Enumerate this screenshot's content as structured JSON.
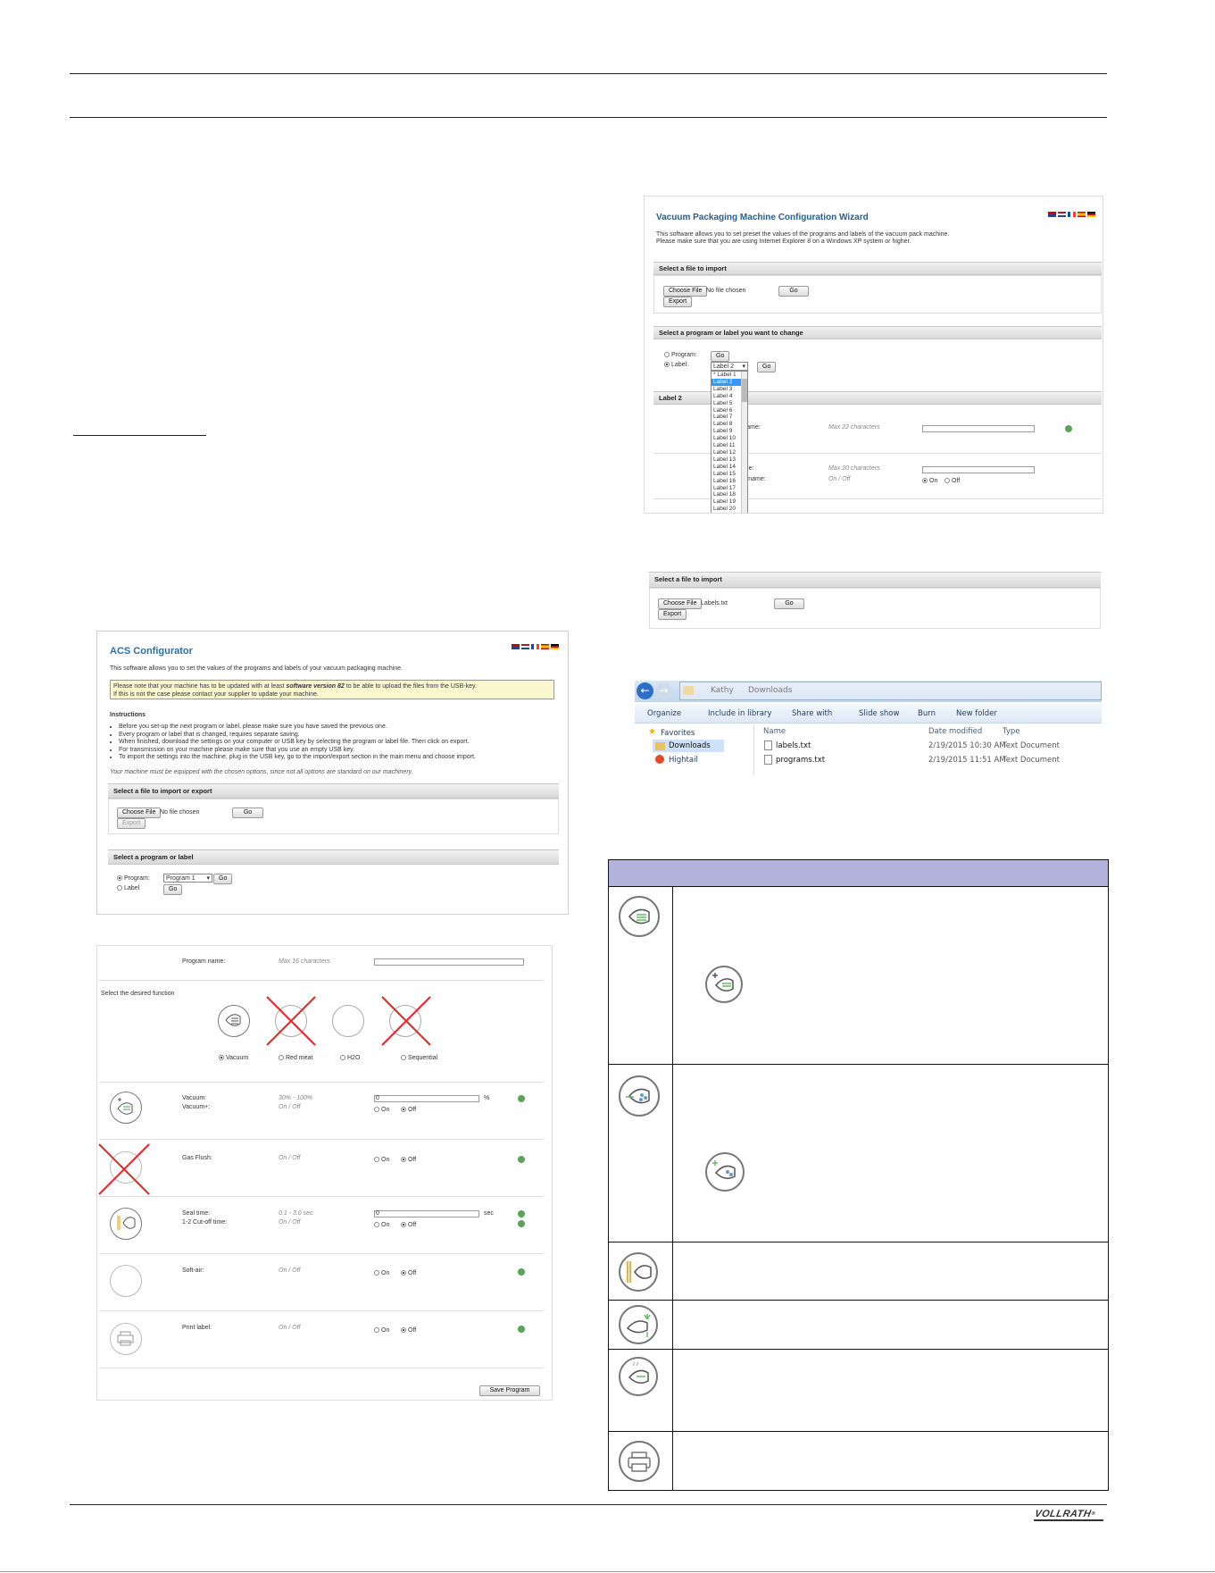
{
  "left_shots": {
    "acs": {
      "title": "ACS Configurator",
      "intro": "This software allows you to set the values of the programs and labels of your vacuum packaging machine.",
      "note_line1_pre": "Please note that your machine has to be updated with at least",
      "note_line1_bold": "software version 82",
      "note_line1_post": "to be able to upload the files from the USB-key.",
      "note_line2": "If this is not the case please contact your supplier to update your machine.",
      "instructions_heading": "Instructions",
      "instructions": [
        "Before you set-up the next program or label, please make sure you have saved the previous one.",
        "Every program or label that is changed, requires separate saving.",
        "When finished, download the settings on your computer or USB key by selecting the program or label file. Then click on export.",
        "For transmission on your machine please make sure that you use an empty USB key.",
        "To import the settings into the machine, plug in the USB key, go to the import/export section in the main menu and choose import."
      ],
      "options_note": "Your machine must be equipped with the chosen options, since not all options are standard on our machinery.",
      "import_section": "Select a file to import or export",
      "choose_file": "Choose File",
      "no_file": "No file chosen",
      "go": "Go",
      "export": "Export",
      "program_section": "Select a program or label",
      "program_label": "Program:",
      "label_label": "Label",
      "program_selected": "Program 1"
    },
    "program_form": {
      "program_name": "Program name:",
      "program_name_hint": "Max 16 characters",
      "select_function": "Select the desired function",
      "functions": [
        "Vacuum",
        "Red meat",
        "H2O",
        "Sequential"
      ],
      "rows": [
        {
          "label1": "Vacuum:",
          "label2": "Vacuum+:",
          "hint1": "30% - 100%",
          "hint2": "On / Off",
          "unit": "%",
          "value": "0"
        },
        {
          "label1": "Gas Flush:",
          "hint1": "On / Off"
        },
        {
          "label1": "Seal time:",
          "label2": "1-2 Cut-off time:",
          "hint1": "0.1 - 3.0 sec",
          "hint2": "On / Off",
          "unit": "sec",
          "value": "0"
        },
        {
          "label1": "Soft-air:",
          "hint1": "On / Off"
        },
        {
          "label1": "Print label:",
          "hint1": "On / Off"
        }
      ],
      "on": "On",
      "off": "Off",
      "save": "Save Program"
    }
  },
  "right_shots": {
    "wizard": {
      "title": "Vacuum Packaging Machine Configuration Wizard",
      "intro1": "This software allows you to set preset the values of the programs and labels of the vacuum pack machine.",
      "intro2": "Please make sure that you are using Internet Explorer 8 on a Windows XP system or higher.",
      "import_section": "Select a file to import",
      "choose_file": "Choose File",
      "no_file": "No file chosen",
      "go": "Go",
      "export": "Export",
      "change_section": "Select a program or label you want to change",
      "program_label": "Program:",
      "label_label": "Label:",
      "label_selected": "Label 2",
      "label_options": [
        "* Label 1",
        "Label 2",
        "Label 3",
        "Label 4",
        "Label 5",
        "Label 6",
        "Label 7",
        "Label 8",
        "Label 9",
        "Label 10",
        "Label 11",
        "Label 12",
        "Label 13",
        "Label 14",
        "Label 15",
        "Label 16",
        "Label 17",
        "Label 18",
        "Label 19",
        "Label 20"
      ],
      "label2_section": "Label 2",
      "text_name": "xt name:",
      "text_name_hint": "Max 22 characters",
      "name2": "name:",
      "name2_hint": "Max 20 characters",
      "gas_name": "gas name:",
      "gas_hint": "On / Off",
      "on": "On",
      "off": "Off"
    },
    "import2": {
      "section": "Select a file to import",
      "choose_file": "Choose File",
      "file": "Labels.txt",
      "go": "Go",
      "export": "Export"
    },
    "explorer": {
      "path": [
        "Kathy",
        "Downloads"
      ],
      "toolbar": [
        "Organize",
        "Include in library",
        "Share with",
        "Slide show",
        "Burn",
        "New folder"
      ],
      "nav": [
        "Favorites",
        "Downloads",
        "Hightail"
      ],
      "columns": [
        "Name",
        "Date modified",
        "Type"
      ],
      "files": [
        {
          "name": "labels.txt",
          "date": "2/19/2015 10:30 AM",
          "type": "Text Document"
        },
        {
          "name": "programs.txt",
          "date": "2/19/2015 11:51 AM",
          "type": "Text Document"
        }
      ]
    }
  },
  "footer": {
    "brand": "VOLLRATH"
  }
}
